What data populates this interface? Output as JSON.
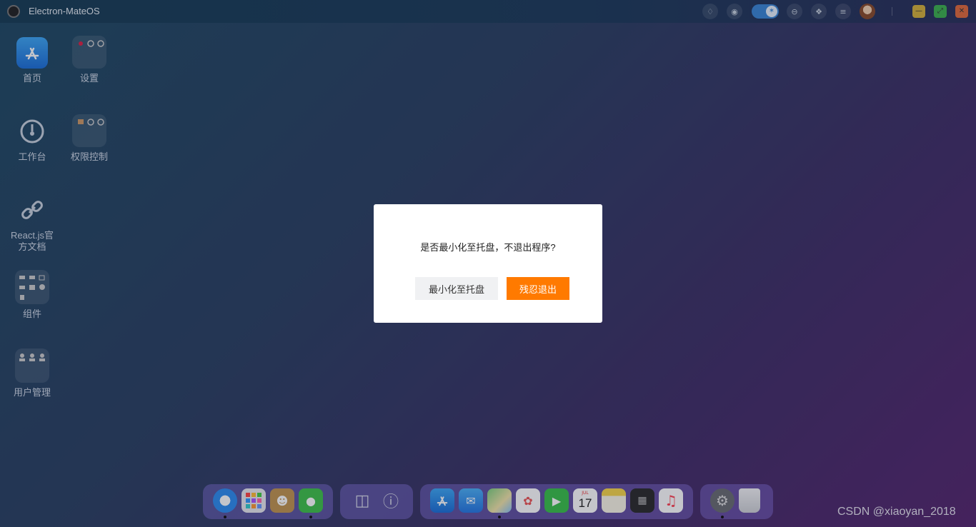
{
  "window": {
    "title": "Electron-MateOS",
    "toolbar_icons": [
      "bell-icon",
      "globe-icon",
      "theme-toggle",
      "shirt-icon",
      "pin-icon",
      "sliders-icon"
    ],
    "window_buttons": [
      "minimize",
      "maximize",
      "close"
    ]
  },
  "desktop": {
    "items": [
      {
        "label": "首页",
        "icon": "app-store-icon"
      },
      {
        "label": "设置",
        "icon": "folder-icon"
      },
      {
        "label": "工作台",
        "icon": "dashboard-icon"
      },
      {
        "label": "权限控制",
        "icon": "folder-icon"
      },
      {
        "label": "React.js官方文档",
        "icon": "link-icon"
      },
      {
        "label": "组件",
        "icon": "folder-icon"
      },
      {
        "label": "用户管理",
        "icon": "folder-icon"
      }
    ]
  },
  "dialog": {
    "message": "是否最小化至托盘，不退出程序?",
    "minimize_label": "最小化至托盘",
    "exit_label": "残忍退出",
    "exit_color": "#ff7a00"
  },
  "dock": {
    "apps": [
      "safari",
      "launchpad",
      "contacts",
      "messages",
      "monitor",
      "info",
      "app-store",
      "mail",
      "maps",
      "photos",
      "facetime",
      "calendar",
      "notes",
      "calculator",
      "music",
      "system-preferences",
      "trash"
    ],
    "calendar_month": "JUL",
    "calendar_day": "17"
  },
  "watermark": "CSDN @xiaoyan_2018"
}
